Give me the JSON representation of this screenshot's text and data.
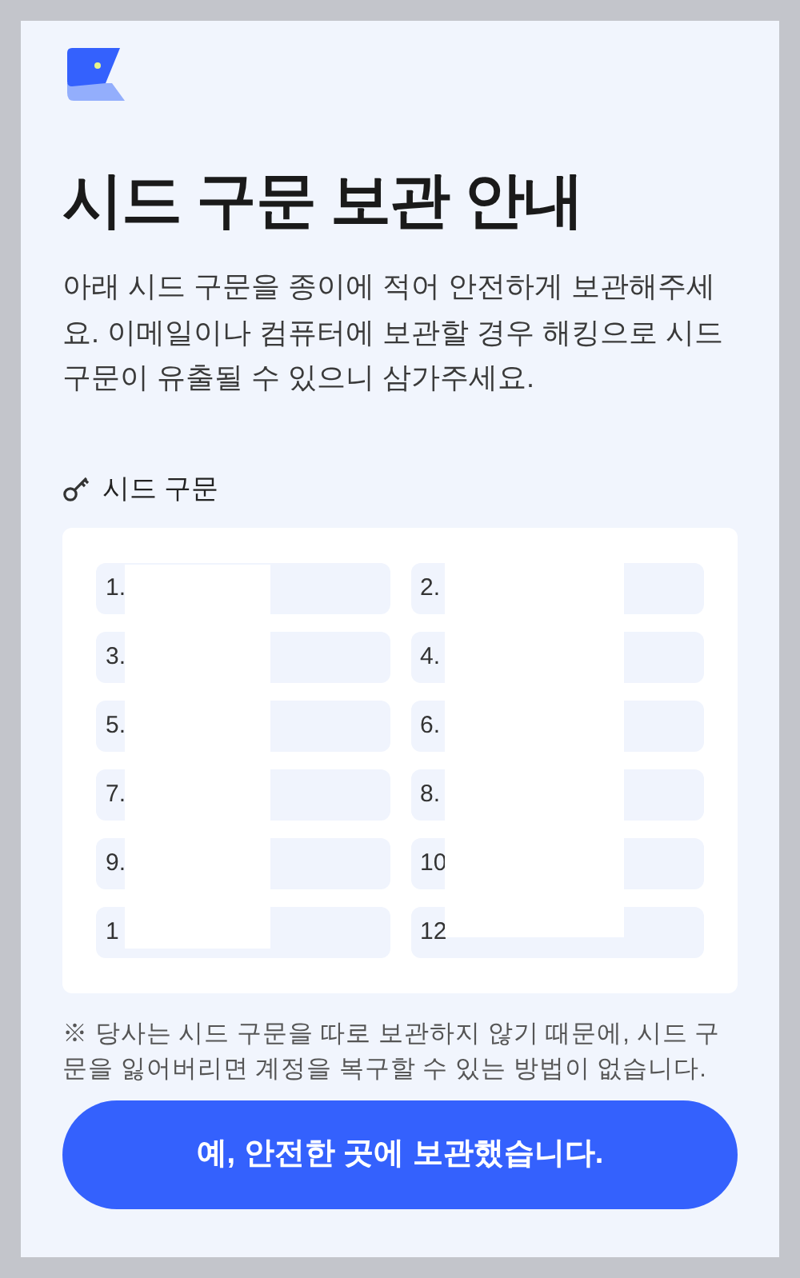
{
  "title": "시드 구문 보관 안내",
  "description": "아래 시드 구문을 종이에 적어 안전하게 보관해주세요. 이메일이나 컴퓨터에 보관할 경우 해킹으로 시드 구문이 유출될 수 있으니 삼가주세요.",
  "section_label": "시드 구문",
  "seed_words": [
    {
      "label": "1."
    },
    {
      "label": "2."
    },
    {
      "label": "3."
    },
    {
      "label": "4."
    },
    {
      "label": "5."
    },
    {
      "label": "6."
    },
    {
      "label": "7."
    },
    {
      "label": "8."
    },
    {
      "label": "9."
    },
    {
      "label": "10"
    },
    {
      "label": "1"
    },
    {
      "label": "12"
    }
  ],
  "note": "※ 당사는 시드 구문을 따로 보관하지 않기 때문에, 시드 구문을 잃어버리면 계정을 복구할 수 있는 방법이 없습니다.",
  "confirm_button": "예, 안전한 곳에 보관했습니다."
}
